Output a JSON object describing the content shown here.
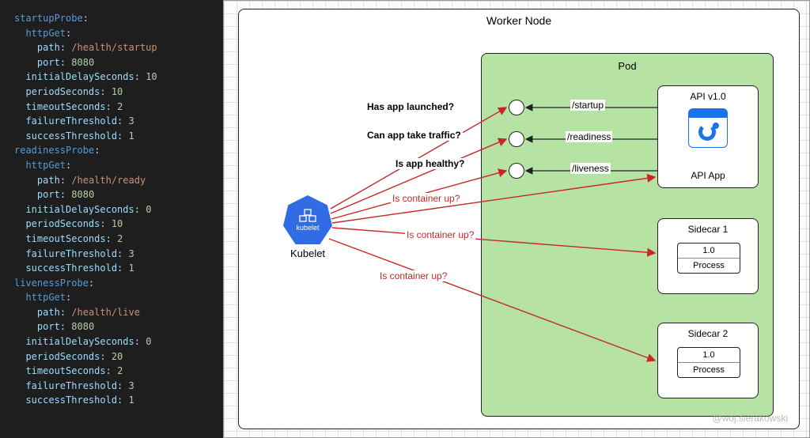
{
  "yaml": {
    "probes": [
      {
        "name": "startupProbe",
        "httpGet": {
          "path": "/health/startup",
          "port": 8080
        },
        "initialDelaySeconds": 10,
        "periodSeconds": 10,
        "timeoutSeconds": 2,
        "failureThreshold": 3,
        "successThreshold": 1
      },
      {
        "name": "readinessProbe",
        "httpGet": {
          "path": "/health/ready",
          "port": 8080
        },
        "initialDelaySeconds": 0,
        "periodSeconds": 10,
        "timeoutSeconds": 2,
        "failureThreshold": 3,
        "successThreshold": 1
      },
      {
        "name": "livenessProbe",
        "httpGet": {
          "path": "/health/live",
          "port": 8080
        },
        "initialDelaySeconds": 0,
        "periodSeconds": 20,
        "timeoutSeconds": 2,
        "failureThreshold": 3,
        "successThreshold": 1
      }
    ]
  },
  "diagram": {
    "worker_node_title": "Worker Node",
    "kubelet_label": "Kubelet",
    "kubelet_inner": "kubelet",
    "pod_title": "Pod",
    "api_container": {
      "title": "API v1.0",
      "name": "API App"
    },
    "sidecar1": {
      "title": "Sidecar 1",
      "version": "1.0",
      "process": "Process"
    },
    "sidecar2": {
      "title": "Sidecar 2",
      "version": "1.0",
      "process": "Process"
    },
    "probes_endpoints": {
      "startup": "/startup",
      "readiness": "/readiness",
      "liveness": "/liveness"
    },
    "questions": {
      "launched": "Has app launched?",
      "traffic": "Can app take traffic?",
      "healthy": "Is app healthy?",
      "container_up": "Is container up?"
    },
    "watermark": "@woj.sierakowski"
  }
}
